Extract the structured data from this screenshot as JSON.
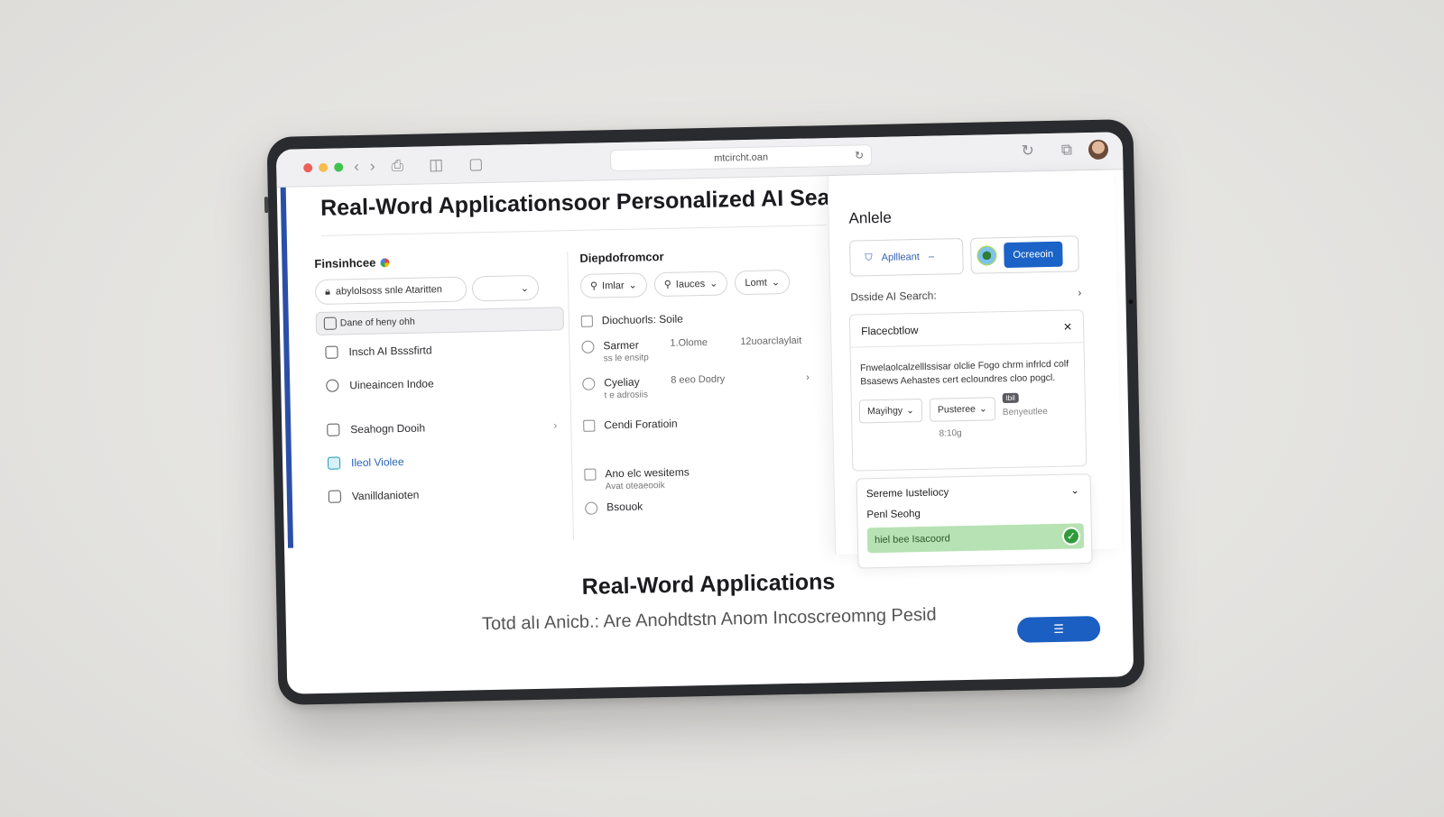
{
  "browser": {
    "url": "mtcircht.oan",
    "colors": {
      "close": "#ee5f57",
      "min": "#f6be4f",
      "max": "#3fc34f"
    }
  },
  "page": {
    "title": "Real-Word Applicationsoor Personalized AI Searc"
  },
  "left": {
    "heading": "Finsinhcee",
    "search_pill": "abylolsoss snle Ataritten",
    "items": [
      {
        "label": "Dane of heny ohh",
        "icon": "calendar-icon",
        "selected": true
      },
      {
        "label": "Insch AI Bsssfirtd",
        "icon": "checkbox-icon"
      },
      {
        "label": "Uineaincen Indoe",
        "icon": "clock-icon"
      },
      {
        "label": "Seahogn Dooih",
        "icon": "building-icon",
        "chevron": "›"
      },
      {
        "label": "Ileol Violee",
        "icon": "edit-icon",
        "active": true
      },
      {
        "label": "Vanilldanioten",
        "icon": "frame-icon"
      }
    ]
  },
  "middle": {
    "heading": "Diepdofromcor",
    "chips": [
      "Imlar",
      "Iauces",
      "Lomt"
    ],
    "options": [
      {
        "type": "checkbox",
        "label": "Diochuorls: Soile"
      },
      {
        "type": "radio",
        "label": "Sarmer",
        "sub": "ss le ensitp",
        "meta1": "1.Olome",
        "meta2": "12uoarclaylait"
      },
      {
        "type": "radio",
        "label": "Cyeliay",
        "sub": "t e adrosiis",
        "meta1": "8 eeo Dodry"
      },
      {
        "type": "checkbox",
        "label": "Cendi Foratioin"
      },
      {
        "type": "checkbox",
        "label": "Ano elc wesitems",
        "sub": "Avat oteaeooik"
      },
      {
        "type": "radio",
        "label": "Bsouok"
      }
    ]
  },
  "panel": {
    "title": "Anlele",
    "seg_label": "Apllleant",
    "seg_dash": "–",
    "button": "Ocreeoin",
    "insight": "Dsside AI Search:",
    "card1": {
      "title": "Flacecbtlow",
      "body": "Fnwelaolcalzelllssisar olclie Fogo chrm infrlcd colf Bsasews Aehastes cert ecloundres cloo pogcl.",
      "select1": "Mayihgy",
      "select2": "Pusteree",
      "tag": "Ibil",
      "tag_text": "Benyeutlee",
      "small": "8:10g"
    },
    "card2": {
      "title": "Sereme Iusteliocy",
      "sub": "Penl Seohg",
      "bar": "hiel bee Isacoord"
    }
  },
  "bottom": {
    "title": "Real-Word Applications",
    "subtitle": "Totd alı Anicb.: Are Anohdtstn Anom Incoscreomng Pesid",
    "cta_icon": "list-icon"
  }
}
